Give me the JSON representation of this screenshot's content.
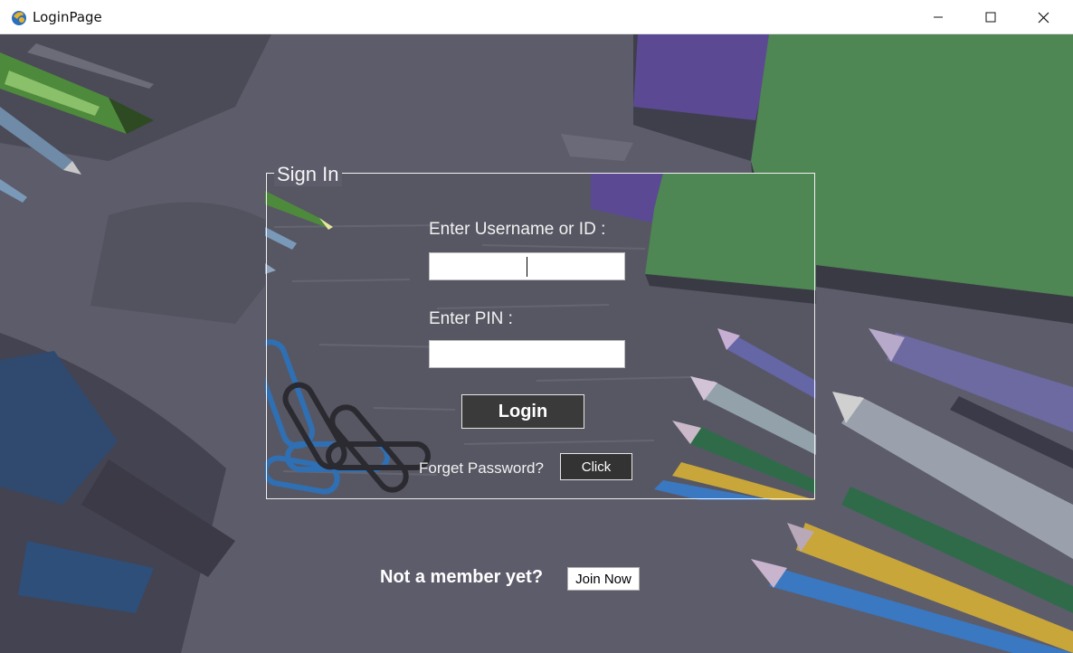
{
  "window": {
    "title": "LoginPage"
  },
  "signin": {
    "legend": "Sign In",
    "username_label": "Enter Username or ID :",
    "username_value": "",
    "pin_label": "Enter PIN :",
    "pin_value": "",
    "login_label": "Login",
    "forget_text": "Forget Password?",
    "forget_button": "Click"
  },
  "footer": {
    "not_member_text": "Not a member yet?",
    "join_button": "Join Now"
  },
  "colors": {
    "background": "#5a5a68",
    "notebook_green": "#4e8654",
    "notebook_purple": "#5b4a93",
    "login_button": "#3a3a3a"
  },
  "icons": [
    "app-icon",
    "minimize-icon",
    "maximize-icon",
    "close-icon"
  ]
}
